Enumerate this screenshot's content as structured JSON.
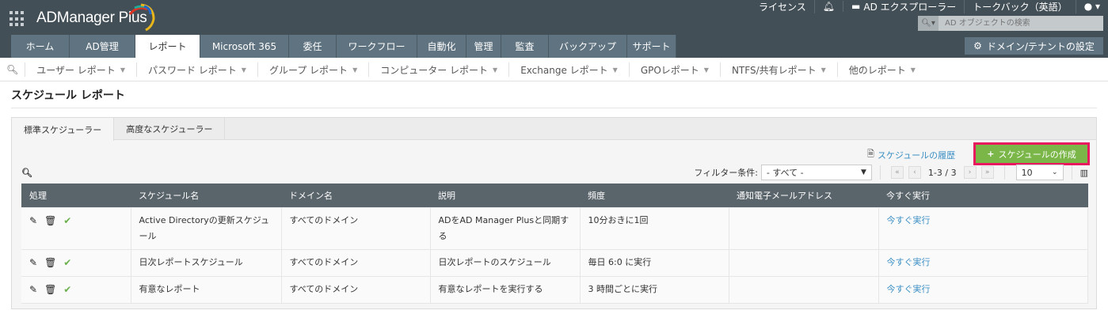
{
  "app": {
    "title": "ADManager Plus"
  },
  "top_links": {
    "license": "ライセンス",
    "explorer": "AD エクスプローラー",
    "talkback": "トークバック（英語）"
  },
  "search": {
    "placeholder": "AD オブジェクトの検索"
  },
  "nav_tabs": [
    {
      "label": "ホーム"
    },
    {
      "label": "AD管理"
    },
    {
      "label": "レポート"
    },
    {
      "label": "Microsoft 365"
    },
    {
      "label": "委任"
    },
    {
      "label": "ワークフロー"
    },
    {
      "label": "自動化"
    },
    {
      "label": "管理"
    },
    {
      "label": "監査"
    },
    {
      "label": "バックアップ"
    },
    {
      "label": "サポート"
    }
  ],
  "domain_settings": "ドメイン/テナントの設定",
  "sub_nav": [
    {
      "label": "ユーザー レポート"
    },
    {
      "label": "パスワード レポート"
    },
    {
      "label": "グループ レポート"
    },
    {
      "label": "コンピューター レポート"
    },
    {
      "label": "Exchange レポート"
    },
    {
      "label": "GPOレポート"
    },
    {
      "label": "NTFS/共有レポート"
    },
    {
      "label": "他のレポート"
    }
  ],
  "page_title": "スケジュール レポート",
  "panel_tabs": [
    {
      "label": "標準スケジューラー"
    },
    {
      "label": "高度なスケジューラー"
    }
  ],
  "history_link": "スケジュールの履歴",
  "create_button": "スケジュールの作成",
  "filter": {
    "label": "フィルター条件:",
    "value": "- すべて -"
  },
  "pagination": {
    "range": "1-3 / 3",
    "page_size": "10"
  },
  "table": {
    "headers": [
      "処理",
      "スケジュール名",
      "ドメイン名",
      "説明",
      "頻度",
      "通知電子メールアドレス",
      "今すぐ実行"
    ],
    "rows": [
      {
        "name": "Active Directoryの更新スケジュール",
        "domain": "すべてのドメイン",
        "desc": "ADをAD Manager Plusと同期する",
        "freq": "10分おきに1回",
        "email": "",
        "run": "今すぐ実行"
      },
      {
        "name": "日次レポートスケジュール",
        "domain": "すべてのドメイン",
        "desc": "日次レポートのスケジュール",
        "freq": "毎日 6:0 に実行",
        "email": "",
        "run": "今すぐ実行"
      },
      {
        "name": "有意なレポート",
        "domain": "すべてのドメイン",
        "desc": "有意なレポートを実行する",
        "freq": "3 時間ごとに実行",
        "email": "",
        "run": "今すぐ実行"
      }
    ]
  },
  "colors": {
    "header_bg": "#434f57",
    "tab_bg": "#5f7380",
    "create_bg": "#7ab648",
    "highlight": "#e8185f",
    "link": "#3b8fc4"
  }
}
